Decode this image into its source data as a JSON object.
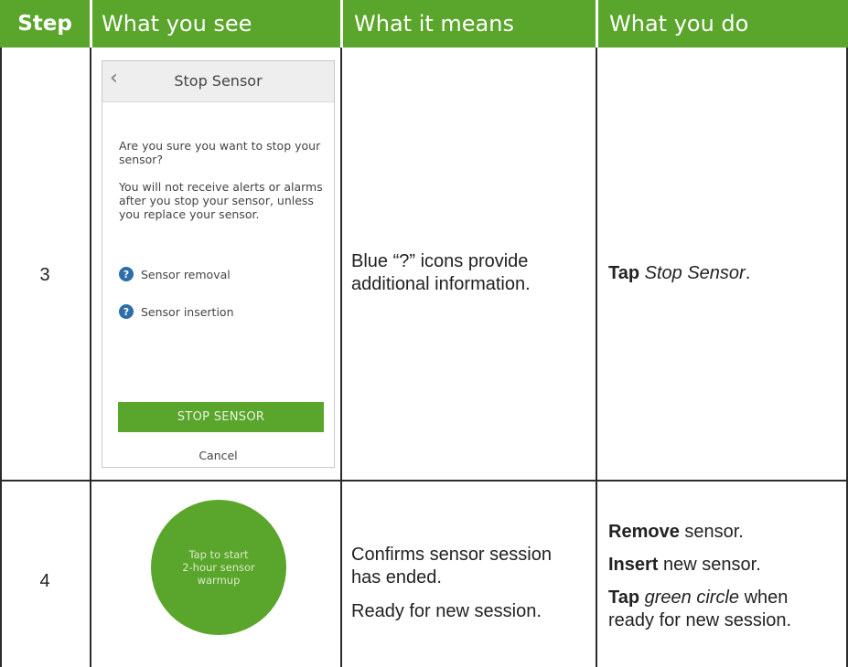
{
  "header": {
    "step": "Step",
    "what_you_see": "What you see",
    "what_it_means": "What it means",
    "what_you_do": "What you do"
  },
  "rows": [
    {
      "step": "3",
      "phone": {
        "back_icon": "chevron-left-icon",
        "title": "Stop Sensor",
        "question": "Are you sure you want to stop your sensor?",
        "warning": "You will not receive alerts or alarms after you stop your sensor, unless you replace your sensor.",
        "help_links": [
          "Sensor removal",
          "Sensor insertion"
        ],
        "help_icon_glyph": "?",
        "button": "STOP SENSOR",
        "cancel": "Cancel"
      },
      "means": [
        "Blue “?” icons provide",
        "additional information."
      ],
      "do": {
        "bold": "Tap",
        "italic": "Stop Sensor",
        "rest": "."
      }
    },
    {
      "step": "4",
      "circle_text": [
        "Tap to start",
        "2-hour sensor",
        "warmup"
      ],
      "means": [
        "Confirms sensor session",
        "has ended.",
        "Ready for new session."
      ],
      "do": [
        {
          "bold": "Remove",
          "rest": " sensor."
        },
        {
          "bold": "Insert",
          "rest": " new sensor."
        },
        {
          "bold": "Tap",
          "italic": "green circle",
          "rest": " when",
          "line2": "ready for new session."
        }
      ]
    }
  ],
  "colors": {
    "header_green": "#5aa52b",
    "help_blue": "#2d6ea8",
    "grid": "#2b2b2b"
  }
}
